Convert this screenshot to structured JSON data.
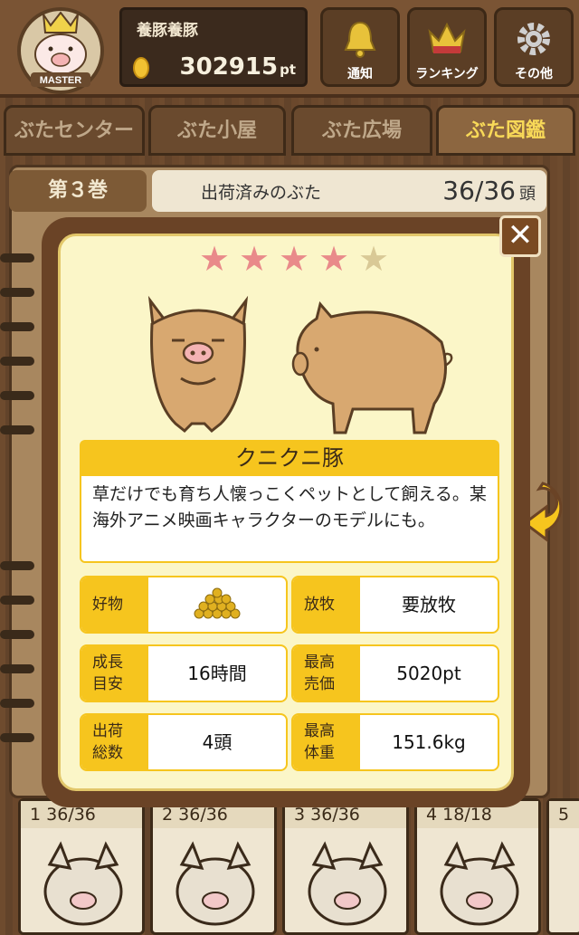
{
  "header": {
    "player_name": "養豚養豚",
    "points_value": "302915",
    "points_unit": "pt",
    "buttons": [
      {
        "label": "通知",
        "icon": "bell-icon"
      },
      {
        "label": "ランキング",
        "icon": "crown-icon"
      },
      {
        "label": "その他",
        "icon": "gear-icon"
      }
    ]
  },
  "tabs": [
    "ぶたセンター",
    "ぶた小屋",
    "ぶた広場",
    "ぶた図鑑"
  ],
  "active_tab": "ぶた図鑑",
  "book": {
    "volume": "第３巻",
    "title": "出荷済みのぶた",
    "count": "36/36",
    "count_unit": "頭"
  },
  "pig": {
    "rating": 4,
    "rating_max": 5,
    "name": "クニクニ豚",
    "description": "草だけでも育ち人懐っこくペットとして飼える。某海外アニメ映画キャラクターのモデルにも。"
  },
  "stats": [
    {
      "key": "好物",
      "value": "",
      "icon": "food-pile-icon"
    },
    {
      "key": "放牧",
      "value": "要放牧"
    },
    {
      "key": "成長\n目安",
      "value": "16時間"
    },
    {
      "key": "最高\n売価",
      "value": "5020pt"
    },
    {
      "key": "出荷\n総数",
      "value": "4頭"
    },
    {
      "key": "最高\n体重",
      "value": "151.6kg"
    }
  ],
  "cards": [
    {
      "num": "1",
      "count": "36/36"
    },
    {
      "num": "2",
      "count": "36/36"
    },
    {
      "num": "3",
      "count": "36/36"
    },
    {
      "num": "4",
      "count": "18/18"
    },
    {
      "num": "5",
      "count": ""
    }
  ],
  "colors": {
    "accent_yellow": "#f6c51e",
    "modal_bg": "#fbf6c8",
    "star_on": "#e98a8a",
    "star_off": "#d9c996"
  }
}
